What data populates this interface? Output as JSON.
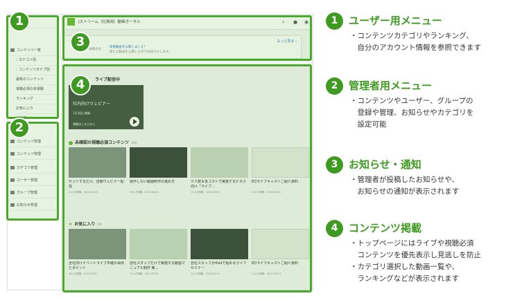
{
  "app": {
    "title": "Jストリーム（社員用）動画ポータル",
    "sidebar": [
      {
        "label": "トップ",
        "kind": "item"
      },
      {
        "label": "コンテンツ一覧",
        "kind": "item"
      },
      {
        "label": "カテゴリ別",
        "kind": "sub"
      },
      {
        "label": "コンテンツタイプ別",
        "kind": "sub"
      },
      {
        "label": "最新のコンテンツ",
        "kind": "plain"
      },
      {
        "label": "視聴必須の未視聴",
        "kind": "plain"
      },
      {
        "label": "ランキング",
        "kind": "plain"
      },
      {
        "label": "お気に入り",
        "kind": "plain"
      },
      {
        "label": "アカウント",
        "kind": "plain"
      },
      {
        "label": "コンテンツ管理",
        "kind": "item"
      },
      {
        "label": "コンテンツ管理",
        "kind": "item"
      },
      {
        "label": "カテゴリ管理",
        "kind": "item"
      },
      {
        "label": "ユーザー管理",
        "kind": "item"
      },
      {
        "label": "グループ管理",
        "kind": "item"
      },
      {
        "label": "お知らせ管理",
        "kind": "item"
      }
    ],
    "notice": {
      "more": "もっと見る ›",
      "label": "お知らせ",
      "line1": "新規動画を公開しました！",
      "line2": "新たな動画を公開したのでお知らせします。"
    },
    "live": {
      "heading": "ライブ配信中",
      "title": "社内向けウェビナー",
      "sub": "1日3回に開催",
      "button": "視聴はこちらから"
    },
    "sections": [
      {
        "title": "未確認の視聴必須コンテンツ",
        "count": "10件",
        "icon": "dot-icon",
        "cards": [
          {
            "title": "セットするだけ、自動ウェビナー配信",
            "meta": "20人が視聴　2021/06/01"
          },
          {
            "title": "操作しない動画制作の進め方",
            "meta": "15人が視聴　2021/06/01"
          },
          {
            "title": "少人数＆低コストで実施するビネス向け「ライブ…",
            "meta": "12人が視聴　2021/06/01"
          },
          {
            "title": "EQライブキャストご紹介資料",
            "meta": "15人が視聴　2021/06/01"
          }
        ]
      },
      {
        "title": "お気に入り",
        "count": "5件",
        "icon": "star-icon",
        "cards": [
          {
            "title": "全社向けイベントライブ中継の事例とポイント",
            "meta": "18人が視聴　2021/05/21"
          },
          {
            "title": "自社スタッフだけで実施する動画マニュアル制作 実…",
            "meta": "12人が視聴　2021/05/21"
          },
          {
            "title": "自社スタッフがiPadで始めるライブセミナー",
            "meta": "14人が視聴　2021/05/21"
          },
          {
            "title": "EQライブキャストご紹介資料",
            "meta": "11人が視聴　2021/05/13"
          }
        ]
      }
    ]
  },
  "badges": [
    "1",
    "2",
    "3",
    "4"
  ],
  "legend": [
    {
      "num": "1",
      "title": "ユーザー用メニュー",
      "lines": [
        "・コンテンツカテゴリやランキング、",
        "　自分のアカウント情報を参照できます"
      ]
    },
    {
      "num": "2",
      "title": "管理者用メニュー",
      "lines": [
        "・コンテンツやユーザー、グループの",
        "　登録や管理、お知らせやカテゴリを",
        "　設定可能"
      ]
    },
    {
      "num": "3",
      "title": "お知らせ・通知",
      "lines": [
        "・管理者が投稿したお知らせや、",
        "　お知らせの通知が表示されます"
      ]
    },
    {
      "num": "4",
      "title": "コンテンツ掲載",
      "lines": [
        "・トップページにはライブや視聴必須",
        "　コンテンツを優先表示し見逃しを防止",
        "・カテゴリ選択した動画一覧や、",
        "　ランキングなどが表示されます"
      ]
    }
  ],
  "colors": {
    "accent": "#3f9a22",
    "frame": "#4aa82a"
  }
}
